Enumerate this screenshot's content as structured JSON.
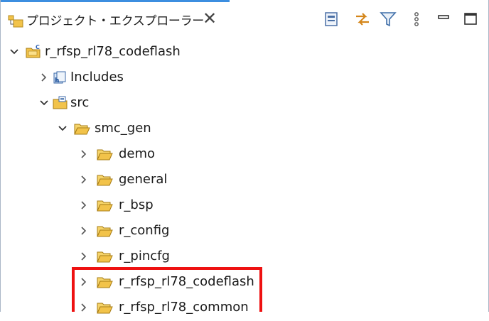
{
  "view": {
    "tab_title": "プロジェクト・エクスプローラー",
    "close_glyph": "✕",
    "toolbar": [
      "collapse-all-icon",
      "link-with-editor-icon",
      "filter-icon",
      "view-menu-icon",
      "minimize-icon",
      "maximize-icon"
    ]
  },
  "tree": {
    "project": "r_rfsp_rl78_codeflash",
    "includes": "Includes",
    "src": "src",
    "smc_gen": "smc_gen",
    "folders": [
      "demo",
      "general",
      "r_bsp",
      "r_config",
      "r_pincfg",
      "r_rfsp_rl78_codeflash",
      "r_rfsp_rl78_common"
    ]
  },
  "colors": {
    "accent": "#3c8ee0",
    "folder": "#f2c34a",
    "highlight": "#ee1111"
  }
}
